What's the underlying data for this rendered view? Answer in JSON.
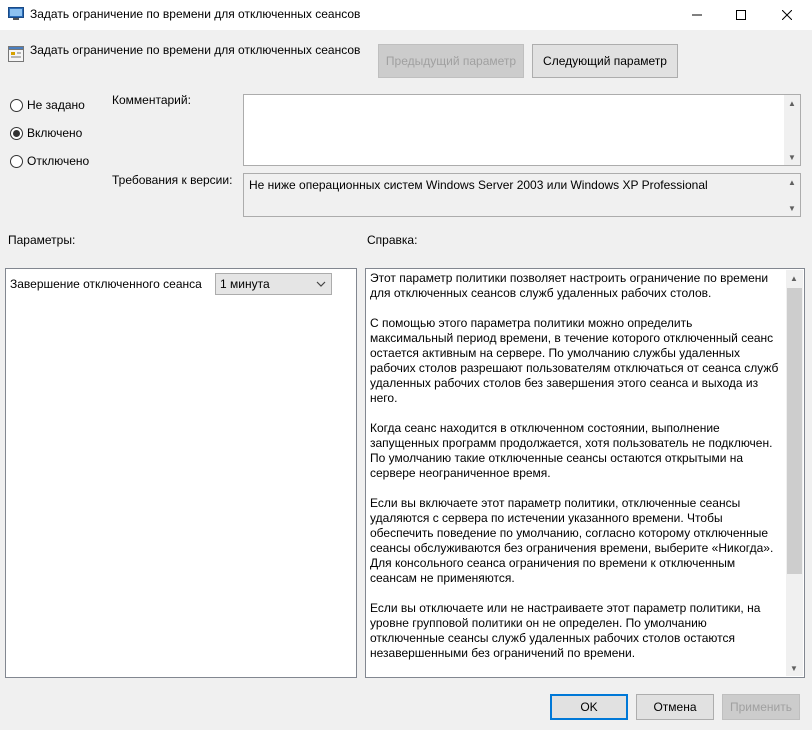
{
  "window": {
    "title": "Задать ограничение по времени для отключенных сеансов",
    "icon": "policy-setting-icon",
    "controls": {
      "minimize": "—",
      "maximize": "☐",
      "close": "✕"
    }
  },
  "header": {
    "policy_title": "Задать ограничение по времени для отключенных сеансов",
    "prev_label": "Предыдущий параметр",
    "next_label": "Следующий параметр"
  },
  "state": {
    "options": [
      {
        "label": "Не задано",
        "selected": false
      },
      {
        "label": "Включено",
        "selected": true
      },
      {
        "label": "Отключено",
        "selected": false
      }
    ]
  },
  "comment": {
    "label": "Комментарий:",
    "value": ""
  },
  "requirements": {
    "label": "Требования к версии:",
    "value": "Не ниже операционных систем Windows Server 2003 или Windows XP Professional"
  },
  "params": {
    "heading": "Параметры:",
    "field_label": "Завершение отключенного сеанса",
    "field_value": "1 минута"
  },
  "help": {
    "heading": "Справка:",
    "paragraphs": [
      "Этот параметр политики позволяет настроить ограничение по времени\nдля отключенных сеансов служб удаленных рабочих столов.",
      "С помощью этого параметра политики можно определить\nмаксимальный период времени, в течение которого отключенный сеанс\nостается активным на сервере. По умолчанию службы удаленных\nрабочих столов разрешают пользователям отключаться от сеанса служб\nудаленных рабочих столов без завершения этого сеанса и выхода из него.",
      "Когда сеанс находится в отключенном состоянии, выполнение\nзапущенных программ продолжается, хотя пользователь не подключен.\nПо умолчанию такие отключенные сеансы остаются открытыми на\nсервере неограниченное время.",
      "Если вы включаете этот параметр политики, отключенные сеансы\nудаляются с сервера по истечении указанного времени. Чтобы\nобеспечить поведение по умолчанию, согласно которому отключенные\nсеансы обслуживаются без ограничения времени, выберите «Никогда».\nДля консольного сеанса ограничения по времени к отключенным\nсеансам не применяются.",
      "Если вы отключаете или не настраиваете этот параметр политики, на\nуровне групповой политики он не определен. По умолчанию\nотключенные сеансы служб удаленных рабочих столов остаются\nнезавершенными без ограничений по времени."
    ]
  },
  "footer": {
    "ok": "OK",
    "cancel": "Отмена",
    "apply": "Применить"
  },
  "colors": {
    "accent": "#0078d7",
    "background": "#f0f0f0"
  }
}
